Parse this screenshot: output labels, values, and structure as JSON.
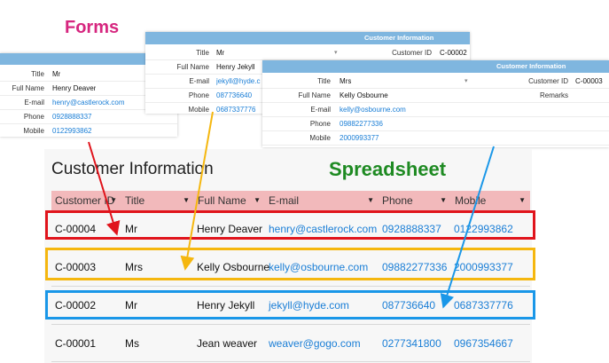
{
  "captions": {
    "forms": "Forms",
    "spreadsheet": "Spreadsheet"
  },
  "forms": [
    {
      "header": "",
      "fields": [
        {
          "label": "Title",
          "value": "Mr"
        },
        {
          "label": "Full Name",
          "value": "Henry Deaver"
        },
        {
          "label": "E-mail",
          "value": "henry@castlerock.com",
          "link": true
        },
        {
          "label": "Phone",
          "value": "0928888337",
          "link": true
        },
        {
          "label": "Mobile",
          "value": "0122993862",
          "link": true
        }
      ]
    },
    {
      "header": "Customer Information",
      "customer_id_label": "Customer ID",
      "customer_id": "C-00002",
      "fields": [
        {
          "label": "Title",
          "value": "Mr"
        },
        {
          "label": "Full Name",
          "value": "Henry Jekyll"
        },
        {
          "label": "E-mail",
          "value": "jekyll@hyde.c",
          "link": true
        },
        {
          "label": "Phone",
          "value": "087736640",
          "link": true
        },
        {
          "label": "Mobile",
          "value": "0687337776",
          "link": true
        }
      ]
    },
    {
      "header": "Customer Information",
      "customer_id_label": "Customer ID",
      "customer_id": "C-00003",
      "remarks_label": "Remarks",
      "fields": [
        {
          "label": "Title",
          "value": "Mrs"
        },
        {
          "label": "Full Name",
          "value": "Kelly Osbourne"
        },
        {
          "label": "E-mail",
          "value": "kelly@osbourne.com",
          "link": true
        },
        {
          "label": "Phone",
          "value": "09882277336",
          "link": true
        },
        {
          "label": "Mobile",
          "value": "2000993377",
          "link": true
        }
      ]
    }
  ],
  "sheet": {
    "title": "Customer Information",
    "columns": [
      "Customer ID",
      "Title",
      "Full Name",
      "E-mail",
      "Phone",
      "Mobile"
    ],
    "rows": [
      [
        "C-00004",
        "Mr",
        "Henry Deaver",
        "henry@castlerock.com",
        "0928888337",
        "0122993862"
      ],
      [
        "C-00003",
        "Mrs",
        "Kelly Osbourne",
        "kelly@osbourne.com",
        "09882277336",
        "2000993377"
      ],
      [
        "C-00002",
        "Mr",
        "Henry Jekyll",
        "jekyll@hyde.com",
        "087736640",
        "0687337776"
      ],
      [
        "C-00001",
        "Ms",
        "Jean weaver",
        "weaver@gogo.com",
        "0277341800",
        "0967354667"
      ]
    ]
  },
  "colors": {
    "forms_caption": "#d6267f",
    "sheet_caption": "#1e8a22",
    "header_fill": "#f2b9bb",
    "form_bar": "#7fb6df",
    "link": "#1a7ed6",
    "highlight_red": "#e0141c",
    "highlight_yellow": "#f5b70f",
    "highlight_blue": "#1a97e8"
  }
}
